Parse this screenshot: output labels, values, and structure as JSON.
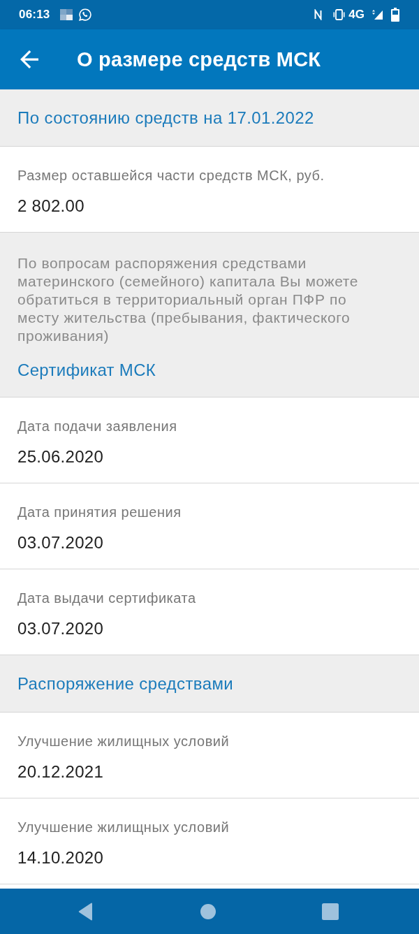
{
  "status_bar": {
    "time": "06:13",
    "network": "4G"
  },
  "app_bar": {
    "title": "О размере средств МСК"
  },
  "content": [
    {
      "kind": "header",
      "text": "По состоянию средств на 17.01.2022"
    },
    {
      "kind": "field",
      "label": "Размер оставшейся части средств МСК, руб.",
      "value": "2 802.00"
    },
    {
      "kind": "note",
      "text": "По вопросам распоряжения средствами материнского (семейного) капитала Вы можете обратиться в территориальный орган ПФР по месту жительства (пребывания, фактического проживания)",
      "link": "Сертификат МСК"
    },
    {
      "kind": "field",
      "label": "Дата подачи заявления",
      "value": "25.06.2020"
    },
    {
      "kind": "field",
      "label": "Дата принятия решения",
      "value": "03.07.2020"
    },
    {
      "kind": "field",
      "label": "Дата выдачи сертификата",
      "value": "03.07.2020"
    },
    {
      "kind": "header",
      "text": "Распоряжение средствами"
    },
    {
      "kind": "field",
      "label": "Улучшение жилищных условий",
      "value": "20.12.2021"
    },
    {
      "kind": "field",
      "label": "Улучшение жилищных условий",
      "value": "14.10.2020"
    }
  ]
}
